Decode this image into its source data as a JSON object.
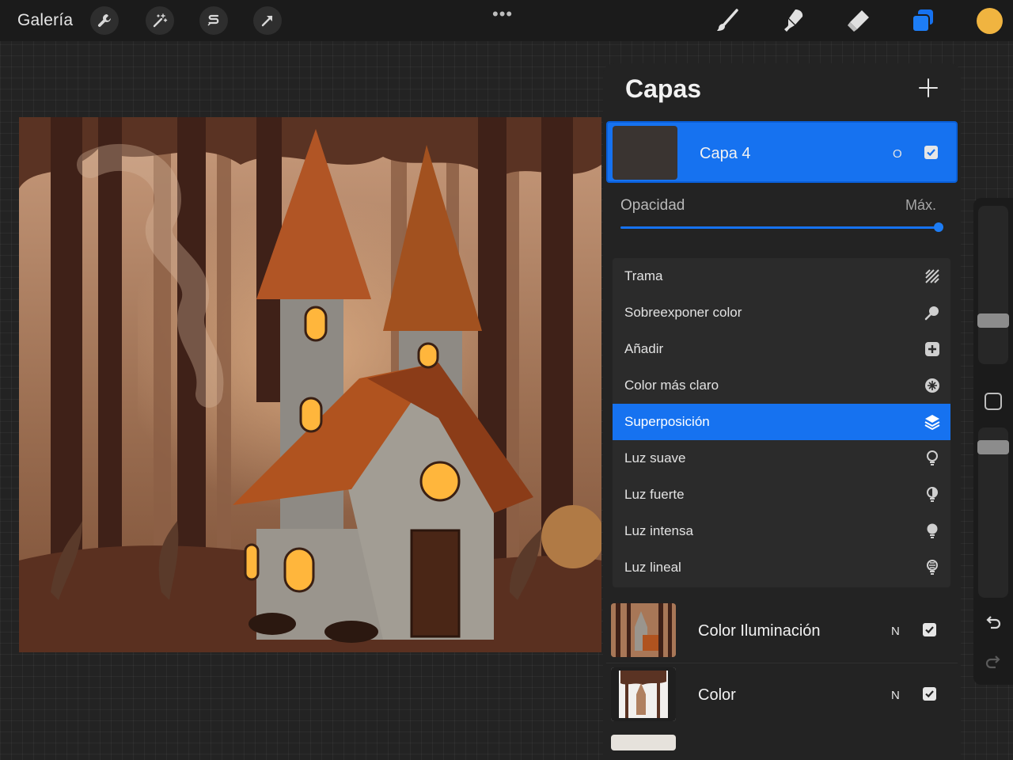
{
  "topbar": {
    "gallery_label": "Galería",
    "left_tools": [
      "wrench-icon",
      "magic-wand-icon",
      "selection-icon",
      "transform-arrow-icon"
    ],
    "menu_dots": "•••",
    "right_tools": [
      "brush-icon",
      "smudge-icon",
      "eraser-icon",
      "layers-icon"
    ],
    "active_color": "#f0b440"
  },
  "layers_panel": {
    "title": "Capas",
    "active_layer": {
      "name": "Capa 4",
      "blend_mode_short": "O",
      "visible": true
    },
    "opacity": {
      "label": "Opacidad",
      "value_label": "Máx.",
      "value": 1.0
    },
    "blend_modes": [
      {
        "label": "Trama",
        "icon": "pattern-icon"
      },
      {
        "label": "Sobreexponer color",
        "icon": "dodge-icon"
      },
      {
        "label": "Añadir",
        "icon": "add-icon"
      },
      {
        "label": "Color más claro",
        "icon": "lighter-color-icon"
      },
      {
        "label": "Superposición",
        "icon": "overlay-layers-icon",
        "selected": true
      },
      {
        "label": "Luz suave",
        "icon": "soft-light-icon"
      },
      {
        "label": "Luz fuerte",
        "icon": "hard-light-icon"
      },
      {
        "label": "Luz intensa",
        "icon": "vivid-light-icon"
      },
      {
        "label": "Luz lineal",
        "icon": "linear-light-icon"
      }
    ],
    "layers": [
      {
        "name": "Color Iluminación",
        "blend_mode_short": "N",
        "visible": true
      },
      {
        "name": "Color",
        "blend_mode_short": "N",
        "visible": true
      }
    ]
  },
  "accent_color": "#1672f0"
}
